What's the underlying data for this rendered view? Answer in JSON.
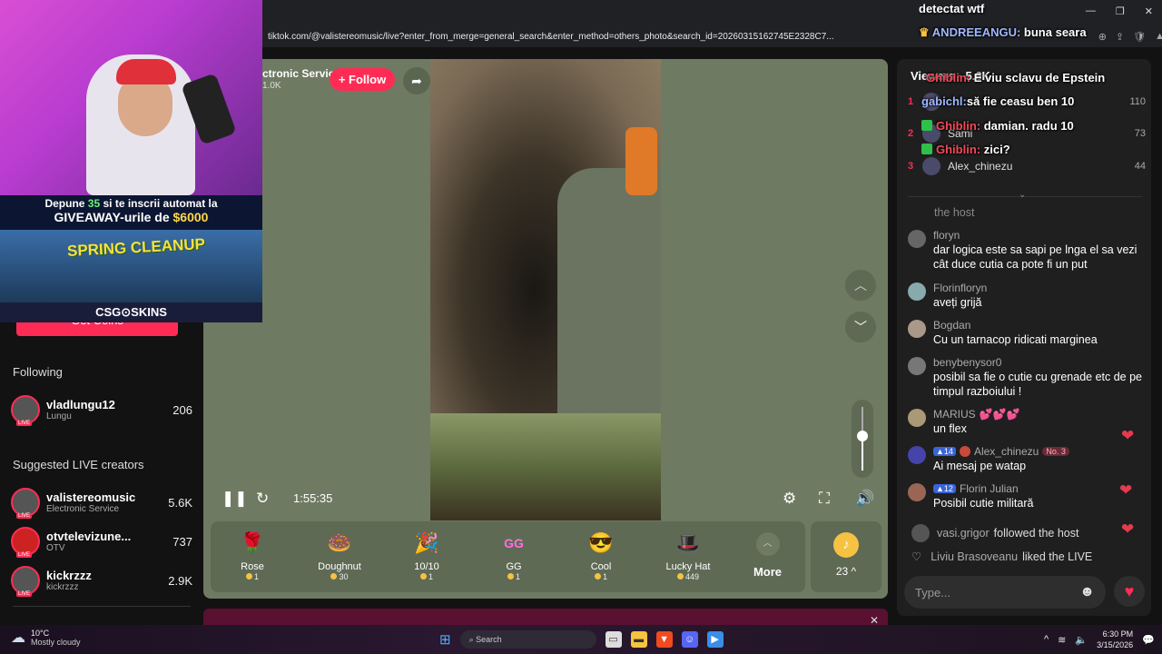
{
  "browser": {
    "url": "tiktok.com/@valistereomusic/live?enter_from_merge=general_search&enter_method=others_photo&search_id=20260315162745E2328C7..."
  },
  "overlay": {
    "promo_line1_a": "Depune ",
    "promo_line1_hl": "35",
    "promo_line1_b": " si te inscrii automat la",
    "promo_line2_a": "GIVEAWAY-urile de ",
    "promo_line2_hl": "$6000",
    "spring_cleanup": "SPRING CLEANUP",
    "brand": "CSG⊙SKINS"
  },
  "sidebar": {
    "get_coins": "Get Coins",
    "following_heading": "Following",
    "following": [
      {
        "name": "vladlungu12",
        "sub": "Lungu",
        "count": "206"
      }
    ],
    "suggested_heading": "Suggested LIVE creators",
    "suggested": [
      {
        "name": "valistereomusic",
        "sub": "Electronic Service",
        "count": "5.6K"
      },
      {
        "name": "otvtelevizune...",
        "sub": "OTV",
        "count": "737"
      },
      {
        "name": "kickrzzz",
        "sub": "kickrzzz",
        "count": "2.9K"
      }
    ],
    "live_badge": "LIVE"
  },
  "player": {
    "host_name": "ctronic Service",
    "host_sub": "1.0K",
    "follow_label": "+ Follow",
    "time": "1:55:35",
    "volume_fraction": 0.55
  },
  "gifts": [
    {
      "name": "Rose",
      "price": "1",
      "icon": "🌹"
    },
    {
      "name": "Doughnut",
      "price": "30",
      "icon": "🍩"
    },
    {
      "name": "10/10",
      "price": "1",
      "icon": "🎉"
    },
    {
      "name": "GG",
      "price": "1",
      "icon": "GG"
    },
    {
      "name": "Cool",
      "price": "1",
      "icon": "😎"
    },
    {
      "name": "Lucky Hat",
      "price": "449",
      "icon": "🎩"
    }
  ],
  "more_label": "More",
  "coins_label": "23",
  "chat": {
    "viewers_heading": "Viewers · 5.6K",
    "ranks": [
      {
        "num": "1",
        "name": "",
        "count": "110"
      },
      {
        "num": "2",
        "name": "Sami",
        "count": "73"
      },
      {
        "num": "3",
        "name": "Alex_chinezu",
        "count": "44"
      }
    ],
    "host_fragment": "the host",
    "messages": [
      {
        "user": "floryn",
        "text": "dar logica este sa sapi pe lnga el sa vezi cât duce cutia ca pote fi un put"
      },
      {
        "user": "Florinfloryn",
        "text": "aveți grijă"
      },
      {
        "user": "Bogdan",
        "text": "Cu un tarnacop ridicati marginea"
      },
      {
        "user": "benybenysor0",
        "text": "posibil sa fie o cutie cu grenade etc de pe timpul razboiului !"
      },
      {
        "user": "MARIUS",
        "text": "un flex"
      },
      {
        "user": "Alex_chinezu",
        "text": "Ai mesaj pe watap",
        "level": "14",
        "no": "No. 3"
      },
      {
        "user": "Florin Julian",
        "text": "Posibil cutie militară",
        "level": "12"
      }
    ],
    "system1_user": "vasi.grigor",
    "system1_text": "followed the host",
    "system2_user": "Liviu Brasoveanu",
    "system2_text": "liked the LIVE",
    "input_placeholder": "Type..."
  },
  "obs": {
    "title": "detectat wtf",
    "lines": [
      {
        "name": "ANDREEANGU:",
        "text": "buna seara"
      },
      {
        "name": "Ghiblin:",
        "text": "E viu sclavu de Epstein"
      },
      {
        "name": "gabichl:",
        "text": "să fie ceasu ben 10"
      },
      {
        "name": "Ghiblin:",
        "text": "damian. radu 10"
      },
      {
        "name": "Ghiblin:",
        "text": "zici?"
      }
    ]
  },
  "taskbar": {
    "temp": "10°C",
    "weather": "Mostly cloudy",
    "search": "Search",
    "time": "6:30 PM",
    "date": "3/15/2026"
  }
}
